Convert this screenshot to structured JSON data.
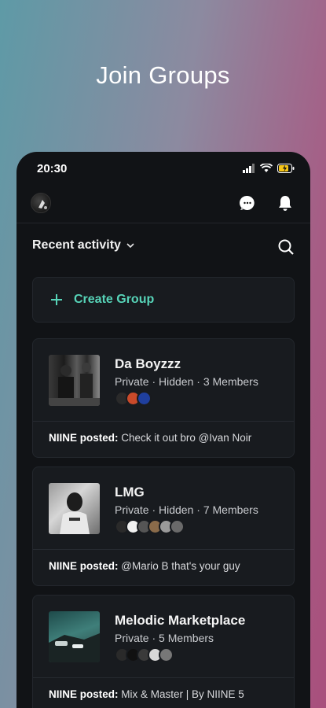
{
  "headline": "Join Groups",
  "status_bar": {
    "time": "20:30"
  },
  "filter": {
    "label": "Recent activity"
  },
  "create_group": {
    "label": "Create Group"
  },
  "groups": [
    {
      "name": "Da Boyzzz",
      "meta": "Private · Hidden · 3 Members",
      "poster": "NIINE posted:",
      "post": "Check it out bro @Ivan Noir"
    },
    {
      "name": "LMG",
      "meta": "Private · Hidden · 7 Members",
      "poster": "NIINE posted:",
      "post": "@Mario B that's your guy"
    },
    {
      "name": "Melodic Marketplace",
      "meta": "Private · 5 Members",
      "poster": "NIINE posted:",
      "post": "Mix & Master | By NIINE 5"
    }
  ],
  "icons": {
    "battery": "battery-charging-icon",
    "wifi": "wifi-icon",
    "signal": "signal-icon",
    "chat": "chat-icon",
    "bell": "bell-icon",
    "search": "search-icon",
    "plus": "plus-icon",
    "chevron": "chevron-down-icon"
  },
  "colors": {
    "accent": "#57d4b8",
    "card_bg": "#181b1f",
    "phone_bg": "#111316"
  }
}
